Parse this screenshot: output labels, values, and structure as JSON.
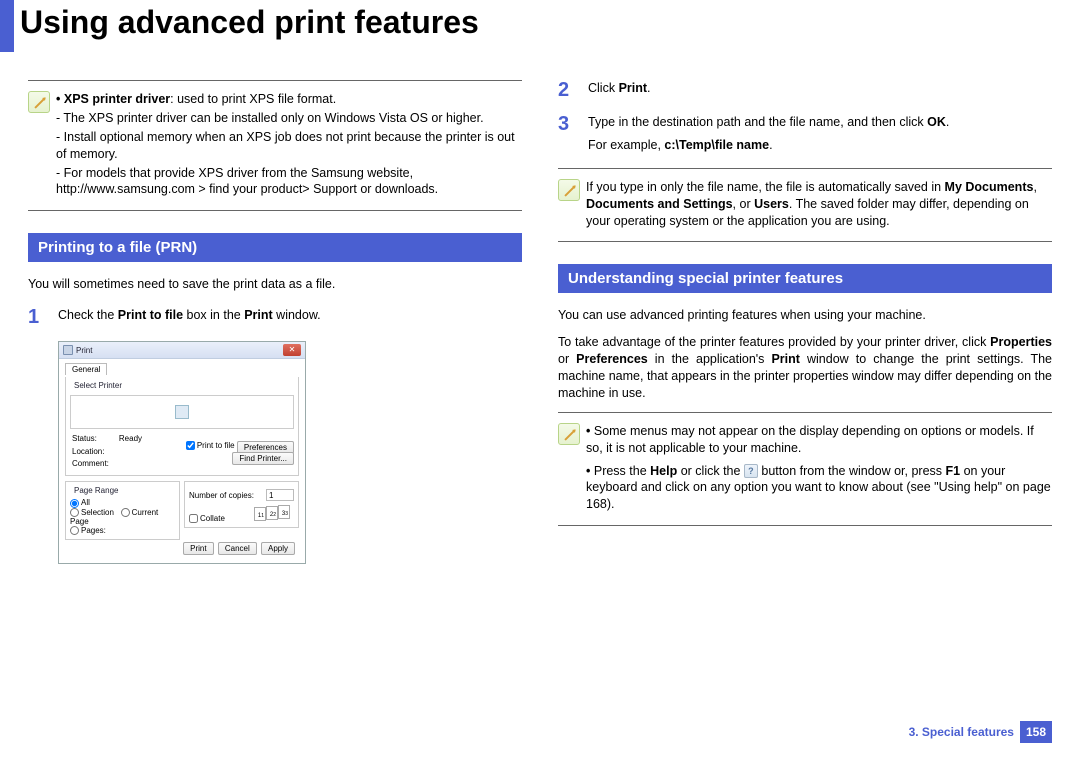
{
  "title": "Using advanced print features",
  "left": {
    "note": {
      "bold": "XPS printer driver",
      "text": ": used to print XPS file format.",
      "sub1": "The XPS printer driver can be installed only on Windows Vista OS or higher.",
      "sub2": "Install optional memory when an XPS job does not print because the printer is out of memory.",
      "sub3": "For models that provide XPS driver from the Samsung website, http://www.samsung.com > find your product> Support or downloads."
    },
    "heading": "Printing to a file (PRN)",
    "para1": "You will sometimes need to save the print data as a file.",
    "step1_pre": "Check the ",
    "step1_b1": "Print to file",
    "step1_mid": " box in the ",
    "step1_b2": "Print",
    "step1_post": " window.",
    "dialog": {
      "title": "Print",
      "tab": "General",
      "selprinter": "Select Printer",
      "status_lbl": "Status:",
      "status_val": "Ready",
      "location_lbl": "Location:",
      "comment_lbl": "Comment:",
      "ptf": "Print to file",
      "pref": "Preferences",
      "find": "Find Printer...",
      "pagerange": "Page Range",
      "all": "All",
      "selection": "Selection",
      "currentpage": "Current Page",
      "pages": "Pages:",
      "copies_lbl": "Number of copies:",
      "copies_val": "1",
      "collate": "Collate",
      "print": "Print",
      "cancel": "Cancel",
      "apply": "Apply"
    }
  },
  "right": {
    "step2_pre": "Click ",
    "step2_b": "Print",
    "step2_post": ".",
    "step3_line1_pre": "Type in the destination path and the file name, and then click ",
    "step3_line1_b": "OK",
    "step3_line1_post": ".",
    "step3_line2_pre": "For example, ",
    "step3_line2_b": "c:\\Temp\\file name",
    "step3_line2_post": ".",
    "note1_pre": "If you type in only the file name, the file is automatically saved in ",
    "note1_b1": "My Documents",
    "note1_mid1": ", ",
    "note1_b2": "Documents and Settings",
    "note1_mid2": ", or ",
    "note1_b3": "Users",
    "note1_post": ". The saved folder may differ, depending on your operating system or the application you are using.",
    "heading": "Understanding special printer features",
    "para2": "You can use advanced printing features when using your machine.",
    "para3_pre": "To take advantage of the printer features provided by your printer driver, click ",
    "para3_b1": "Properties",
    "para3_mid1": " or ",
    "para3_b2": "Preferences",
    "para3_mid2": " in the application's ",
    "para3_b3": "Print",
    "para3_post": " window to change the print settings. The machine name, that appears in the printer properties window may differ depending on the machine in use.",
    "note2_li1": "Some menus may not appear on the display depending on options or models. If so, it is not applicable to your machine.",
    "note2_li2_pre": "Press the ",
    "note2_li2_b1": "Help",
    "note2_li2_mid1": " or click the ",
    "note2_li2_mid2": " button from the window or, press ",
    "note2_li2_b2": "F1",
    "note2_li2_post": " on your keyboard and click on any option you want to know about (see \"Using help\" on page 168)."
  },
  "footer": {
    "chapter": "3.  Special features",
    "page": "158"
  }
}
